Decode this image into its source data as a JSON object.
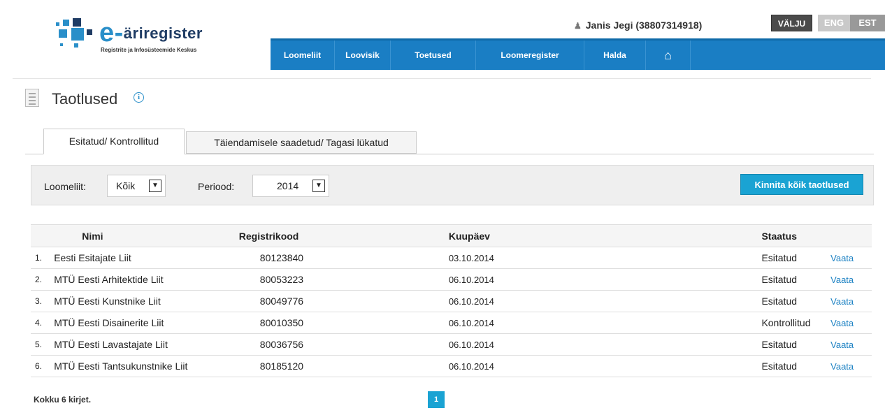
{
  "header": {
    "logo_brand": "äriregister",
    "logo_letter": "e-",
    "logo_subtitle": "Registrite ja Infosüsteemide Keskus",
    "user": "Janis Jegi (38807314918)",
    "logout": "VÄLJU",
    "lang_eng": "ENG",
    "lang_est": "EST"
  },
  "nav": {
    "items": [
      {
        "label": "Loomeliit"
      },
      {
        "label": "Loovisik"
      },
      {
        "label": "Toetused"
      },
      {
        "label": "Loomeregister"
      },
      {
        "label": "Halda"
      }
    ],
    "home_icon": "home-icon"
  },
  "page": {
    "title": "Taotlused",
    "info_glyph": "i"
  },
  "tabs": [
    {
      "label": "Esitatud/ Kontrollitud"
    },
    {
      "label": "Täiendamisele saadetud/ Tagasi lükatud"
    }
  ],
  "filter": {
    "loomeliit_label": "Loomeliit:",
    "loomeliit_value": "Kõik",
    "periood_label": "Periood:",
    "periood_value": "2014",
    "confirm_all": "Kinnita kõik taotlused"
  },
  "table": {
    "headers": {
      "name": "Nimi",
      "code": "Registrikood",
      "date": "Kuupäev",
      "status": "Staatus"
    },
    "rows": [
      {
        "num": "1.",
        "name": "Eesti Esitajate Liit",
        "code": "80123840",
        "date": "03.10.2014",
        "status": "Esitatud",
        "action": "Vaata"
      },
      {
        "num": "2.",
        "name": "MTÜ Eesti Arhitektide Liit",
        "code": "80053223",
        "date": "06.10.2014",
        "status": "Esitatud",
        "action": "Vaata"
      },
      {
        "num": "3.",
        "name": "MTÜ Eesti Kunstnike Liit",
        "code": "80049776",
        "date": "06.10.2014",
        "status": "Esitatud",
        "action": "Vaata"
      },
      {
        "num": "4.",
        "name": "MTÜ Eesti Disainerite Liit",
        "code": "80010350",
        "date": "06.10.2014",
        "status": "Kontrollitud",
        "action": "Vaata"
      },
      {
        "num": "5.",
        "name": "MTÜ Eesti Lavastajate Liit",
        "code": "80036756",
        "date": "06.10.2014",
        "status": "Esitatud",
        "action": "Vaata"
      },
      {
        "num": "6.",
        "name": "MTÜ Eesti Tantsukunstnike Liit",
        "code": "80185120",
        "date": "06.10.2014",
        "status": "Esitatud",
        "action": "Vaata"
      }
    ]
  },
  "footer": {
    "total": "Kokku 6 kirjet.",
    "page": "1"
  },
  "colors": {
    "nav_blue": "#1a7ec4",
    "accent": "#1aa3d3",
    "link": "#1f83c4"
  }
}
